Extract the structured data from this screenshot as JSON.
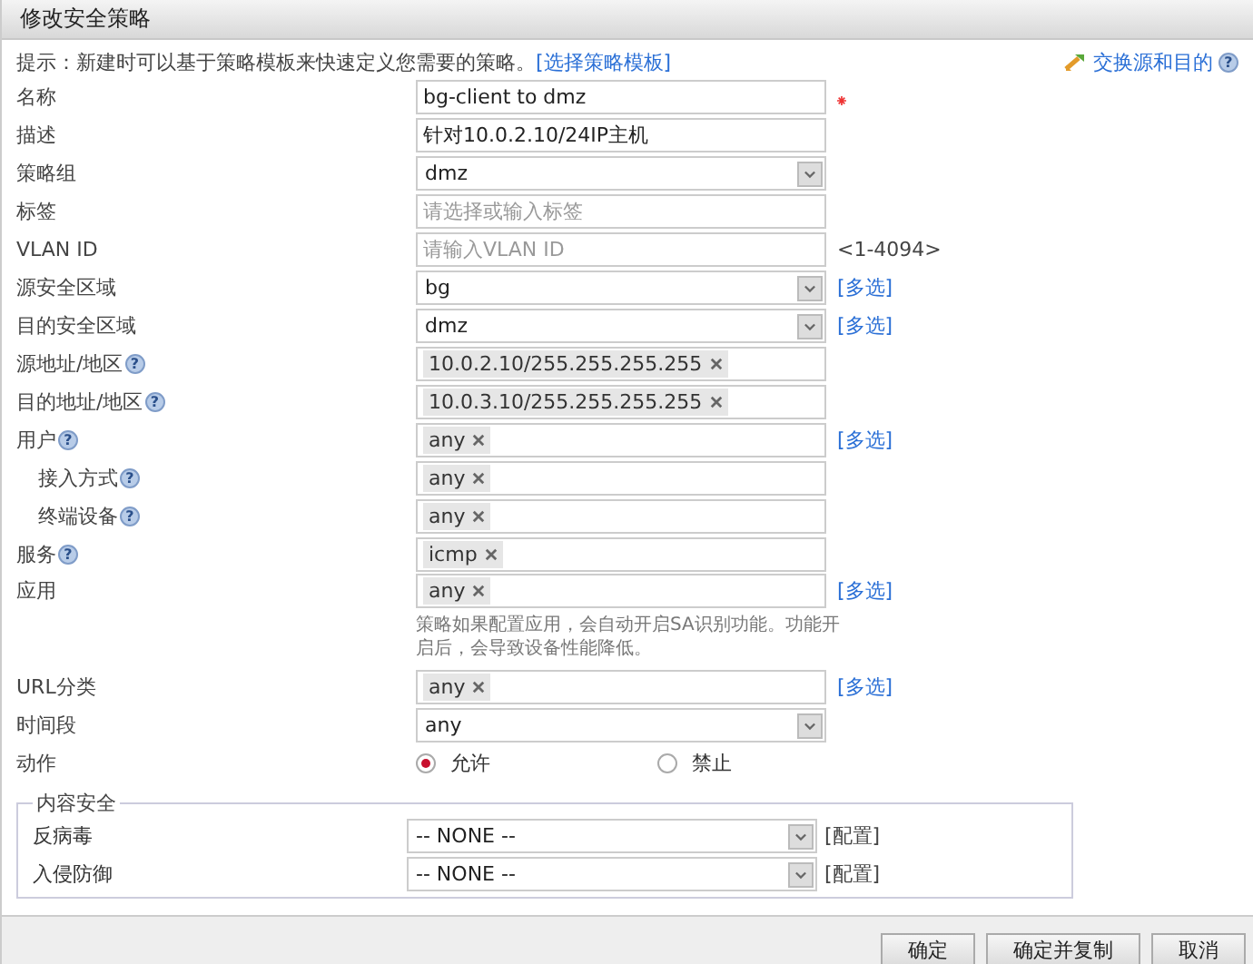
{
  "window": {
    "title": "修改安全策略"
  },
  "hint": {
    "text": "提示：新建时可以基于策略模板来快速定义您需要的策略。",
    "link": "[选择策略模板]"
  },
  "swap_link": "交换源和目的",
  "swap_help": "?",
  "fields": [
    {
      "label": "名称",
      "kind": "text",
      "value": "bg-client to dmz",
      "required": true
    },
    {
      "label": "描述",
      "kind": "text",
      "value": "针对10.0.2.10/24IP主机"
    },
    {
      "label": "策略组",
      "kind": "select",
      "value": "dmz"
    },
    {
      "label": "标签",
      "kind": "text",
      "placeholder": "请选择或输入标签"
    },
    {
      "label": "VLAN ID",
      "kind": "text",
      "placeholder": "请输入VLAN ID",
      "suffix": "<1-4094>"
    },
    {
      "label": "源安全区域",
      "kind": "select",
      "value": "bg",
      "link": "[多选]"
    },
    {
      "label": "目的安全区域",
      "kind": "select",
      "value": "dmz",
      "link": "[多选]"
    },
    {
      "label": "源地址/地区",
      "kind": "tags",
      "help": "?",
      "tags": [
        "10.0.2.10/255.255.255.255"
      ]
    },
    {
      "label": "目的地址/地区",
      "kind": "tags",
      "help": "?",
      "tags": [
        "10.0.3.10/255.255.255.255"
      ]
    },
    {
      "label": "用户",
      "kind": "tags",
      "help": "?",
      "tags": [
        "any"
      ],
      "link": "[多选]",
      "children": [
        {
          "label": "接入方式",
          "kind": "tags",
          "help": "?",
          "tags": [
            "any"
          ]
        },
        {
          "label": "终端设备",
          "kind": "tags",
          "help": "?",
          "tags": [
            "any"
          ]
        }
      ]
    },
    {
      "label": "服务",
      "kind": "tags",
      "help": "?",
      "tags": [
        "icmp"
      ]
    },
    {
      "label": "应用",
      "kind": "tags",
      "tags": [
        "any"
      ],
      "link": "[多选]",
      "note": "策略如果配置应用，会自动开启SA识别功能。功能开启后，会导致设备性能降低。"
    },
    {
      "label": "URL分类",
      "kind": "tags",
      "tags": [
        "any"
      ],
      "link": "[多选]"
    },
    {
      "label": "时间段",
      "kind": "select",
      "value": "any"
    },
    {
      "label": "动作",
      "kind": "radio",
      "options": [
        {
          "label": "允许",
          "selected": true
        },
        {
          "label": "禁止",
          "selected": false
        }
      ]
    }
  ],
  "content_security": {
    "title": "内容安全",
    "rows": [
      {
        "label": "反病毒",
        "value": "-- NONE --",
        "link": "[配置]"
      },
      {
        "label": "入侵防御",
        "value": "-- NONE --",
        "link": "[配置]"
      }
    ]
  },
  "buttons": [
    "确定",
    "确定并复制",
    "取消"
  ]
}
